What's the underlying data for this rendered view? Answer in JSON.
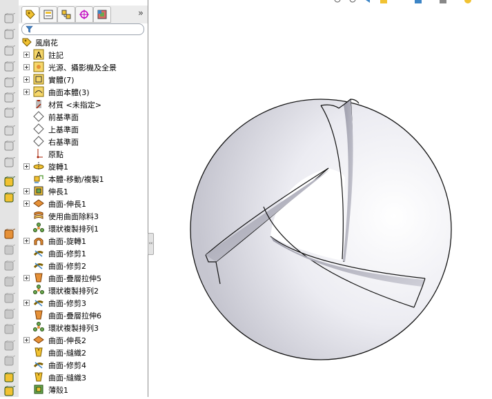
{
  "left_toolbar": {
    "buttons": [
      "plane-icon",
      "plane-icon",
      "plane-icon",
      "plane-icon",
      "plane-icon",
      "plane-icon",
      "solid-box-icon",
      "sketch-icon",
      "smart-dimension-icon",
      "relations-icon",
      "extrude-icon",
      "extrude-icon",
      "revolve-icon",
      "sweep-icon",
      "loft-icon",
      "fillet-icon",
      "chamfer-icon",
      "rib-icon",
      "shell-icon",
      "draft-icon",
      "hole-icon",
      "dome-icon",
      "boss-icon",
      "surface-icon"
    ]
  },
  "panel": {
    "tabs": [
      "feature-manager",
      "property-manager",
      "configuration-manager",
      "dimxpert-manager",
      "display-manager"
    ],
    "more_label": "»",
    "filter_placeholder": ""
  },
  "tree": {
    "root": {
      "label": "風扇花"
    },
    "items": [
      {
        "label": "註記",
        "expander": true,
        "icon": "annotations"
      },
      {
        "label": "光源、攝影機及全景",
        "expander": true,
        "icon": "lights"
      },
      {
        "label": "實體(7)",
        "expander": true,
        "icon": "solid-bodies"
      },
      {
        "label": "曲面本體(3)",
        "expander": true,
        "icon": "surface-bodies"
      },
      {
        "label": "材質 <未指定>",
        "expander": false,
        "icon": "material"
      },
      {
        "label": "前基準面",
        "expander": false,
        "icon": "plane"
      },
      {
        "label": "上基準面",
        "expander": false,
        "icon": "plane"
      },
      {
        "label": "右基準面",
        "expander": false,
        "icon": "plane"
      },
      {
        "label": "原點",
        "expander": false,
        "icon": "origin"
      },
      {
        "label": "旋轉1",
        "expander": true,
        "icon": "revolve"
      },
      {
        "label": "本體-移動/複製1",
        "expander": false,
        "icon": "move-copy"
      },
      {
        "label": "伸長1",
        "expander": true,
        "icon": "extrude"
      },
      {
        "label": "曲面-伸長1",
        "expander": true,
        "icon": "surface-extrude"
      },
      {
        "label": "使用曲面除料3",
        "expander": false,
        "icon": "surface-cut"
      },
      {
        "label": "環狀複製排列1",
        "expander": false,
        "icon": "circular-pattern"
      },
      {
        "label": "曲面-旋轉1",
        "expander": true,
        "icon": "surface-revolve"
      },
      {
        "label": "曲面-修剪1",
        "expander": false,
        "icon": "surface-trim"
      },
      {
        "label": "曲面-修剪2",
        "expander": false,
        "icon": "surface-trim"
      },
      {
        "label": "曲面-疊層拉伸5",
        "expander": true,
        "icon": "surface-loft"
      },
      {
        "label": "環狀複製排列2",
        "expander": false,
        "icon": "circular-pattern"
      },
      {
        "label": "曲面-修剪3",
        "expander": true,
        "icon": "surface-trim"
      },
      {
        "label": "曲面-疊層拉伸6",
        "expander": false,
        "icon": "surface-loft"
      },
      {
        "label": "環狀複製排列3",
        "expander": false,
        "icon": "circular-pattern"
      },
      {
        "label": "曲面-伸長2",
        "expander": true,
        "icon": "surface-extrude"
      },
      {
        "label": "曲面-縫織2",
        "expander": false,
        "icon": "surface-knit"
      },
      {
        "label": "曲面-修剪4",
        "expander": false,
        "icon": "surface-trim"
      },
      {
        "label": "曲面-縫織3",
        "expander": false,
        "icon": "surface-knit"
      },
      {
        "label": "薄殼1",
        "expander": false,
        "icon": "shell"
      }
    ]
  },
  "splitter_glyph": "‹‹",
  "viewport": {
    "model": "sphere-with-three-swirled-blades",
    "colors": {
      "face": "#ececf2",
      "shade": "#b0b0bc",
      "edge": "#1a1a1a",
      "background": "#ffffff"
    }
  }
}
